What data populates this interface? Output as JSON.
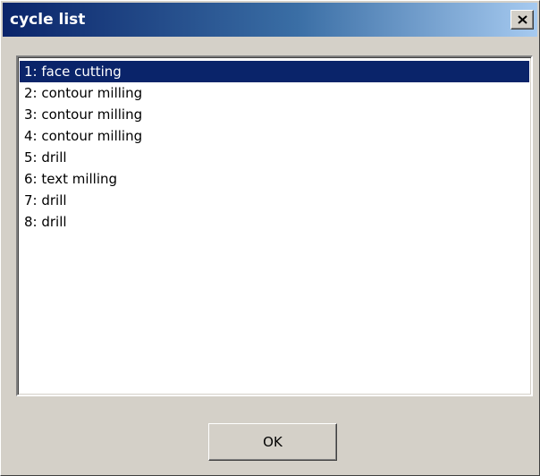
{
  "window": {
    "title": "cycle list"
  },
  "cycles": {
    "items": [
      "1: face cutting",
      "2: contour milling",
      "3: contour milling",
      "4: contour milling",
      "5: drill",
      "6: text milling",
      "7: drill",
      "8: drill"
    ],
    "selected_index": 0
  },
  "buttons": {
    "ok_label": "OK",
    "close_icon": "close-icon"
  },
  "colors": {
    "titlebar_start": "#0a246a",
    "titlebar_end": "#a6caf0",
    "selection": "#0a246a",
    "face": "#d4d0c8"
  }
}
